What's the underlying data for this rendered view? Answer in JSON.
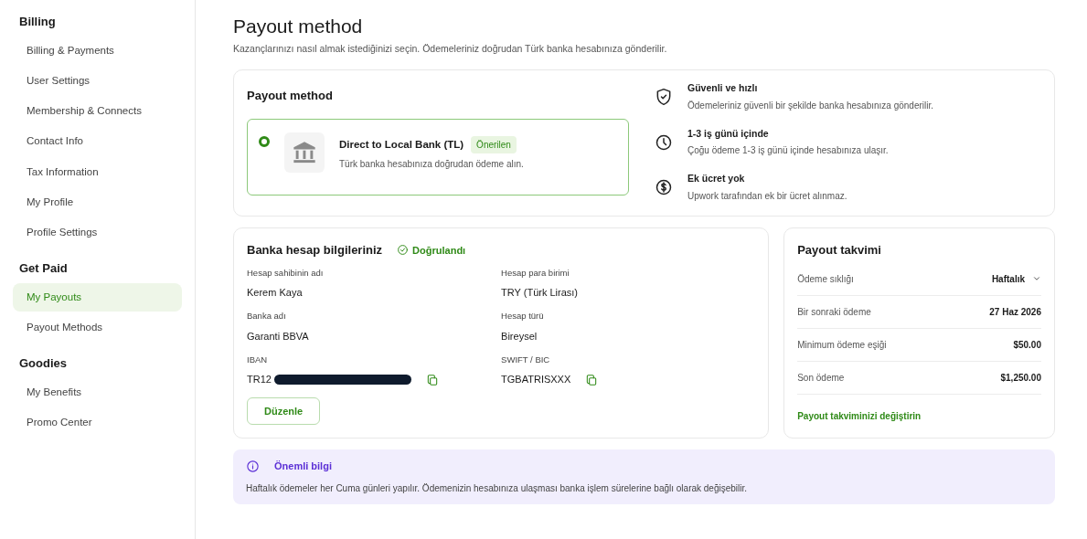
{
  "sidebar": {
    "sections": [
      {
        "title": "Billing",
        "items": [
          {
            "label": "Billing & Payments",
            "selected": false
          },
          {
            "label": "User Settings",
            "selected": false
          },
          {
            "label": "Membership & Connects",
            "selected": false
          },
          {
            "label": "Contact Info",
            "selected": false
          },
          {
            "label": "Tax Information",
            "selected": false
          },
          {
            "label": "My Profile",
            "selected": false
          },
          {
            "label": "Profile Settings",
            "selected": false
          }
        ]
      },
      {
        "title": "Get Paid",
        "items": [
          {
            "label": "My Payouts",
            "selected": true
          },
          {
            "label": "Payout Methods",
            "selected": false
          }
        ]
      },
      {
        "title": "Goodies",
        "items": [
          {
            "label": "My Benefits",
            "selected": false
          },
          {
            "label": "Promo Center",
            "selected": false
          }
        ]
      }
    ]
  },
  "page": {
    "title": "Payout method",
    "subtitle": "Kazançlarınızı nasıl almak istediğinizi seçin. Ödemeleriniz doğrudan Türk banka hesabınıza gönderilir."
  },
  "payout_method": {
    "title": "Payout method",
    "options": [
      {
        "name": "Direct to Local Bank (TL)",
        "badge": "Önerilen",
        "description": "Türk banka hesabınıza doğrudan ödeme alın.",
        "selected": true
      }
    ],
    "benefits": [
      {
        "kind": "shield",
        "title": "Güvenli ve hızlı",
        "text": "Ödemeleriniz güvenli bir şekilde banka hesabınıza gönderilir."
      },
      {
        "kind": "clock",
        "title": "1-3 iş günü içinde",
        "text": "Çoğu ödeme 1-3 iş günü içinde hesabınıza ulaşır."
      },
      {
        "kind": "dollar",
        "title": "Ek ücret yok",
        "text": "Upwork tarafından ek bir ücret alınmaz."
      }
    ]
  },
  "bank_account": {
    "title": "Banka hesap bilgileriniz",
    "status": "Doğrulandı",
    "fields": [
      {
        "label": "Hesap sahibinin adı",
        "value": "Kerem Kaya"
      },
      {
        "label": "Hesap para birimi",
        "value": "TRY (Türk Lirası)"
      },
      {
        "label": "Banka adı",
        "value": "Garanti BBVA"
      },
      {
        "label": "Hesap türü",
        "value": "Bireysel"
      },
      {
        "label": "IBAN",
        "value": "TR12",
        "redacted": true,
        "copyable": true
      },
      {
        "label": "SWIFT / BIC",
        "value": "TGBATRISXXX",
        "copyable": true
      }
    ],
    "edit_button": "Düzenle"
  },
  "schedule": {
    "title": "Payout takvimi",
    "rows": [
      {
        "label": "Ödeme sıklığı",
        "value": "Haftalık",
        "dropdown": true
      },
      {
        "label": "Bir sonraki ödeme",
        "value": "27 Haz 2026"
      },
      {
        "label": "Minimum ödeme eşiği",
        "value": "$50.00"
      },
      {
        "label": "Son ödeme",
        "value": "$1,250.00"
      }
    ],
    "link": "Payout takviminizi değiştirin"
  },
  "notice": {
    "title": "Önemli bilgi",
    "text": "Haftalık ödemeler her Cuma günleri yapılır. Ödemenizin hesabınıza ulaşması banka işlem sürelerine bağlı olarak değişebilir."
  }
}
